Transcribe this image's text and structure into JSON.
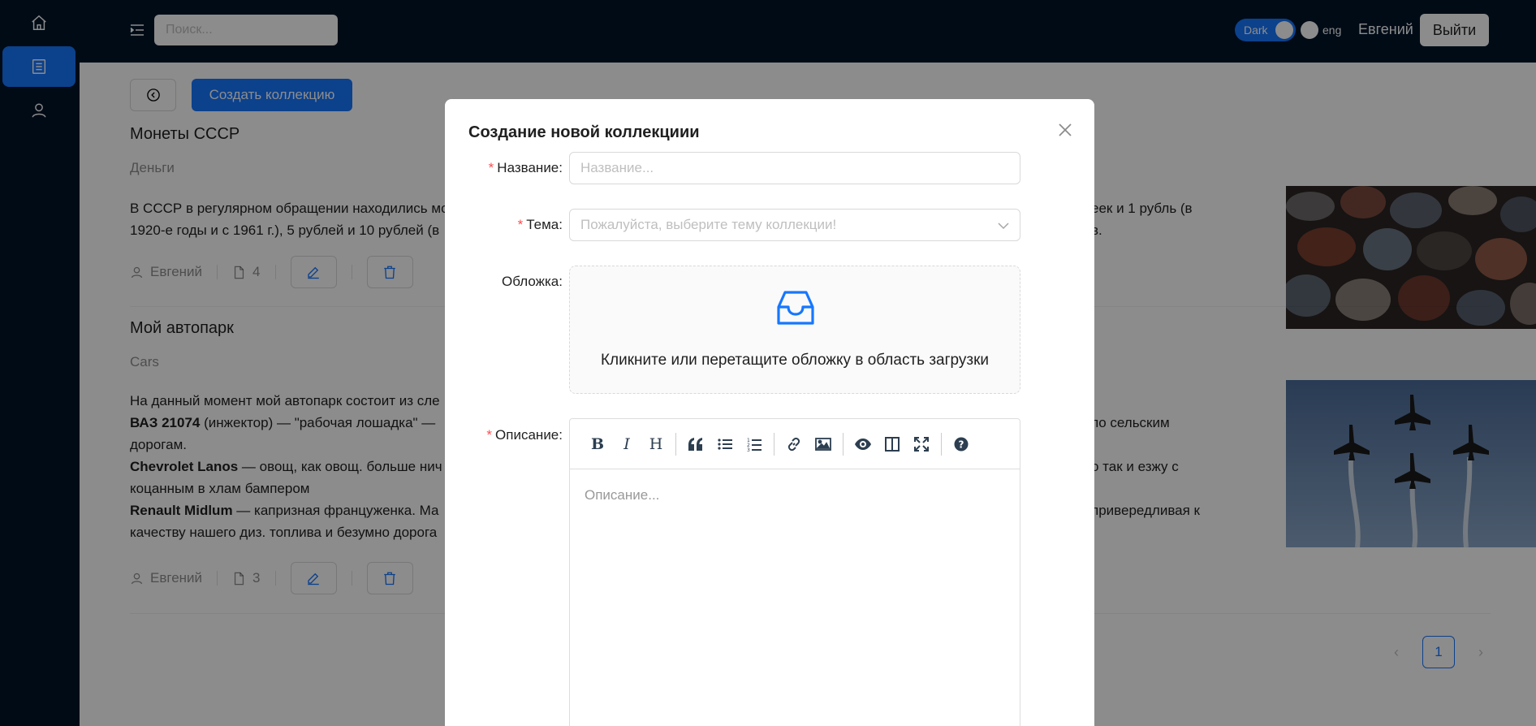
{
  "header": {
    "search_placeholder": "Поиск...",
    "dark_label": "Dark",
    "lang_label": "eng",
    "username": "Евгений",
    "logout_label": "Выйти"
  },
  "toolbar": {
    "create_label": "Создать коллекцию"
  },
  "collections": [
    {
      "title": "Монеты СССР",
      "topic": "Деньги",
      "desc_line1_left": "В СССР в регулярном обращении находились мо",
      "desc_line1_right": "еек и 1 рубль (в",
      "desc_line2_left": "1920-е годы и с 1961 г.), 5 рублей и 10 рублей (в",
      "desc_line2_right": "в.",
      "author": "Евгений",
      "count": "4"
    },
    {
      "title": "Мой автопарк",
      "topic": "Cars",
      "line1": "На данный момент мой автопарк состоит из сле",
      "car1_name": "ВАЗ 21074",
      "car1_text": " (инжектор) — \"рабочая лошадка\" —",
      "car1_right": "по сельским",
      "car1_line2": "дорогам.",
      "car2_name": "Chevrolet Lanos",
      "car2_text": " — овощ, как овощ. больше нич",
      "car2_right": "о так и езжу с",
      "car2_line2": "коцанным в хлам бампером",
      "car3_name": "Renault Midlum",
      "car3_text": " — капризная француженка. Ма",
      "car3_right": "привередливая к",
      "car3_line2": "качеству нашего диз. топлива и безумно дорога",
      "author": "Евгений",
      "count": "3"
    }
  ],
  "pagination": {
    "current": "1"
  },
  "modal": {
    "title": "Создание новой коллекциии",
    "name_label": "Название",
    "name_placeholder": "Название...",
    "topic_label": "Тема",
    "topic_placeholder": "Пожалуйста, выберите тему коллекции!",
    "cover_label": "Обложка",
    "upload_text": "Кликните или перетащите обложку в область загрузки",
    "description_label": "Описание",
    "description_placeholder": "Описание...",
    "required_mark": "*",
    "colon": ":"
  },
  "colors": {
    "primary": "#1677ff",
    "nav_bg": "#001529",
    "danger": "#ff4d4f"
  }
}
